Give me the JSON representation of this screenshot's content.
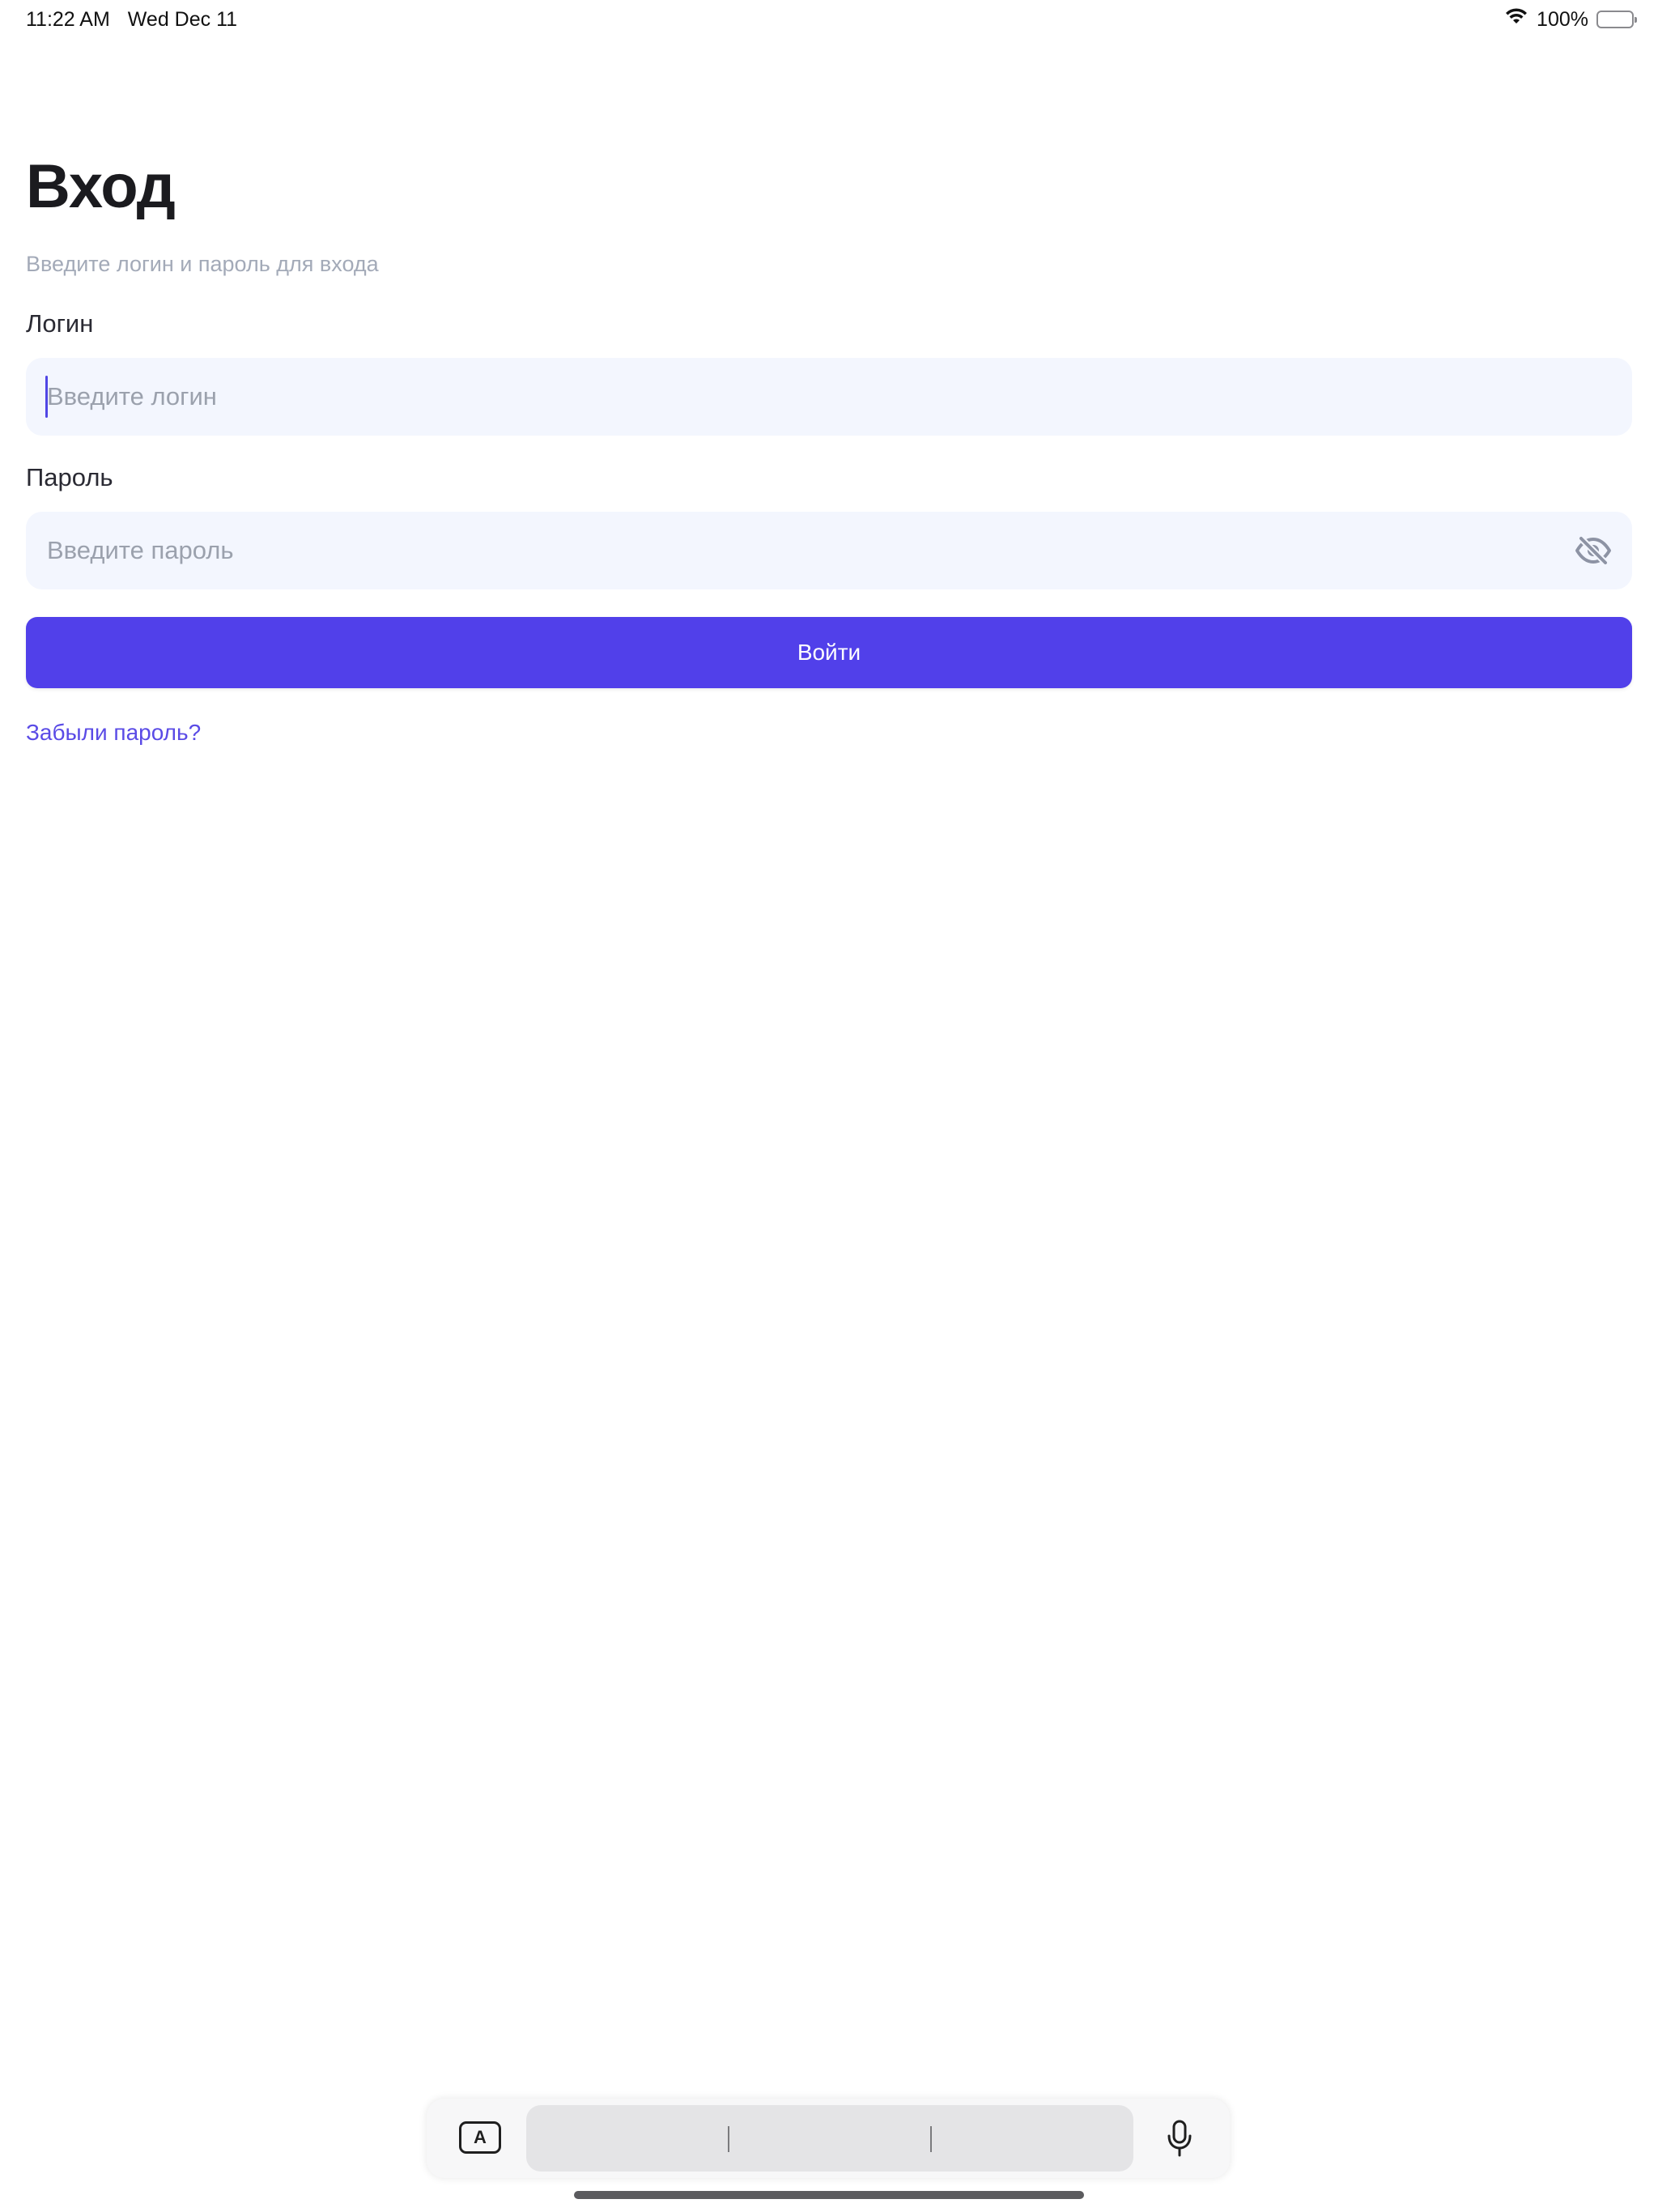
{
  "status_bar": {
    "time": "11:22 AM",
    "date": "Wed Dec 11",
    "battery_percent": "100%",
    "icons": [
      "wifi-icon",
      "battery-icon"
    ]
  },
  "login_screen": {
    "title": "Вход",
    "subtitle": "Введите логин и пароль для входа",
    "login_label": "Логин",
    "login_placeholder": "Введите логин",
    "login_value": "",
    "password_label": "Пароль",
    "password_placeholder": "Введите пароль",
    "password_value": "",
    "password_toggle_icon": "eye-slash-icon",
    "submit_label": "Войти",
    "forgot_password_label": "Забыли пароль?"
  },
  "keyboard_bar": {
    "format_key_label": "A",
    "icons": [
      "text-format-icon",
      "microphone-icon"
    ]
  },
  "colors": {
    "accent": "#5140ea",
    "field_background": "#f3f6fe",
    "link": "#5a4be6",
    "subtitle": "#a3aab8",
    "title": "#1b1b1f"
  }
}
